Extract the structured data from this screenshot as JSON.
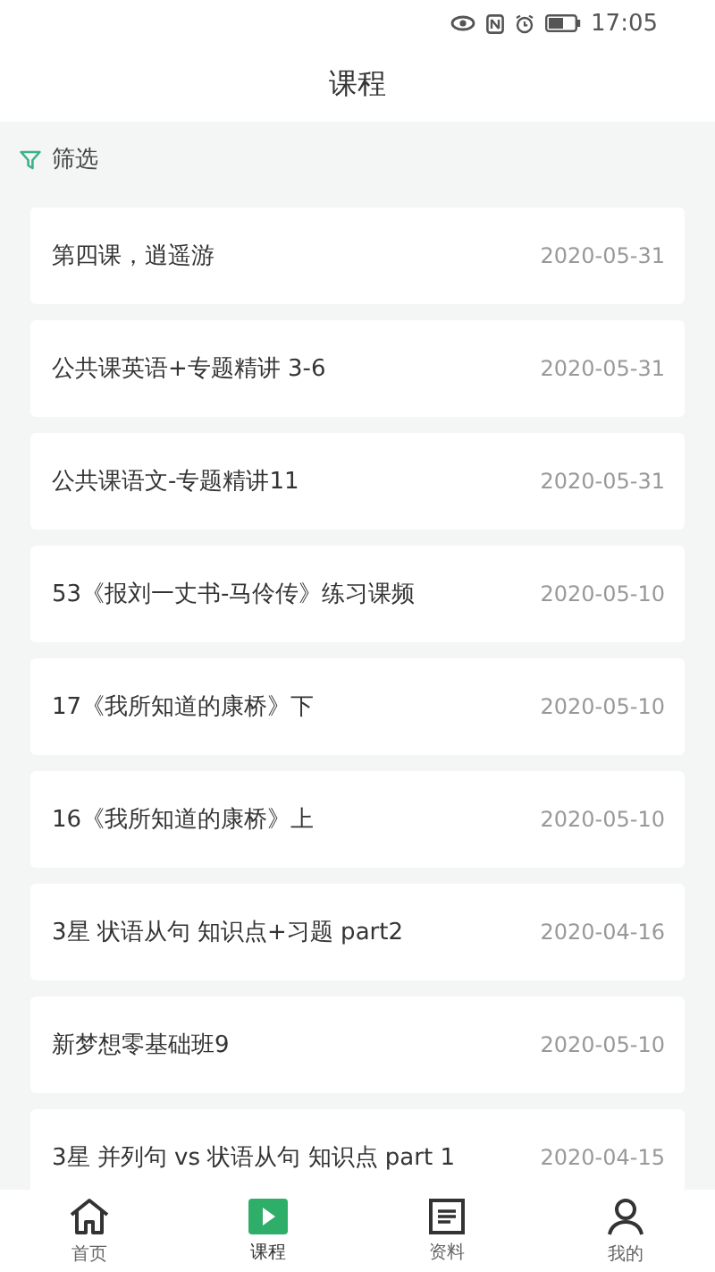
{
  "status_bar": {
    "time": "17:05"
  },
  "header": {
    "title": "课程"
  },
  "filter": {
    "label": "筛选"
  },
  "courses": [
    {
      "title": "第四课，逍遥游",
      "date": "2020-05-31"
    },
    {
      "title": "公共课英语+专题精讲 3-6",
      "date": "2020-05-31"
    },
    {
      "title": "公共课语文-专题精讲11",
      "date": "2020-05-31"
    },
    {
      "title": "53《报刘一丈书-马伶传》练习课频",
      "date": "2020-05-10"
    },
    {
      "title": "17《我所知道的康桥》下",
      "date": "2020-05-10"
    },
    {
      "title": "16《我所知道的康桥》上",
      "date": "2020-05-10"
    },
    {
      "title": "3星 状语从句 知识点+习题 part2",
      "date": "2020-04-16"
    },
    {
      "title": "新梦想零基础班9",
      "date": "2020-05-10"
    },
    {
      "title": "3星 并列句 vs 状语从句 知识点 part 1",
      "date": "2020-04-15"
    }
  ],
  "bottom_nav": [
    {
      "kind": "home",
      "label": "首页",
      "selected": false
    },
    {
      "kind": "play",
      "label": "课程",
      "selected": true
    },
    {
      "kind": "doc",
      "label": "资料",
      "selected": false
    },
    {
      "kind": "user",
      "label": "我的",
      "selected": false
    }
  ]
}
